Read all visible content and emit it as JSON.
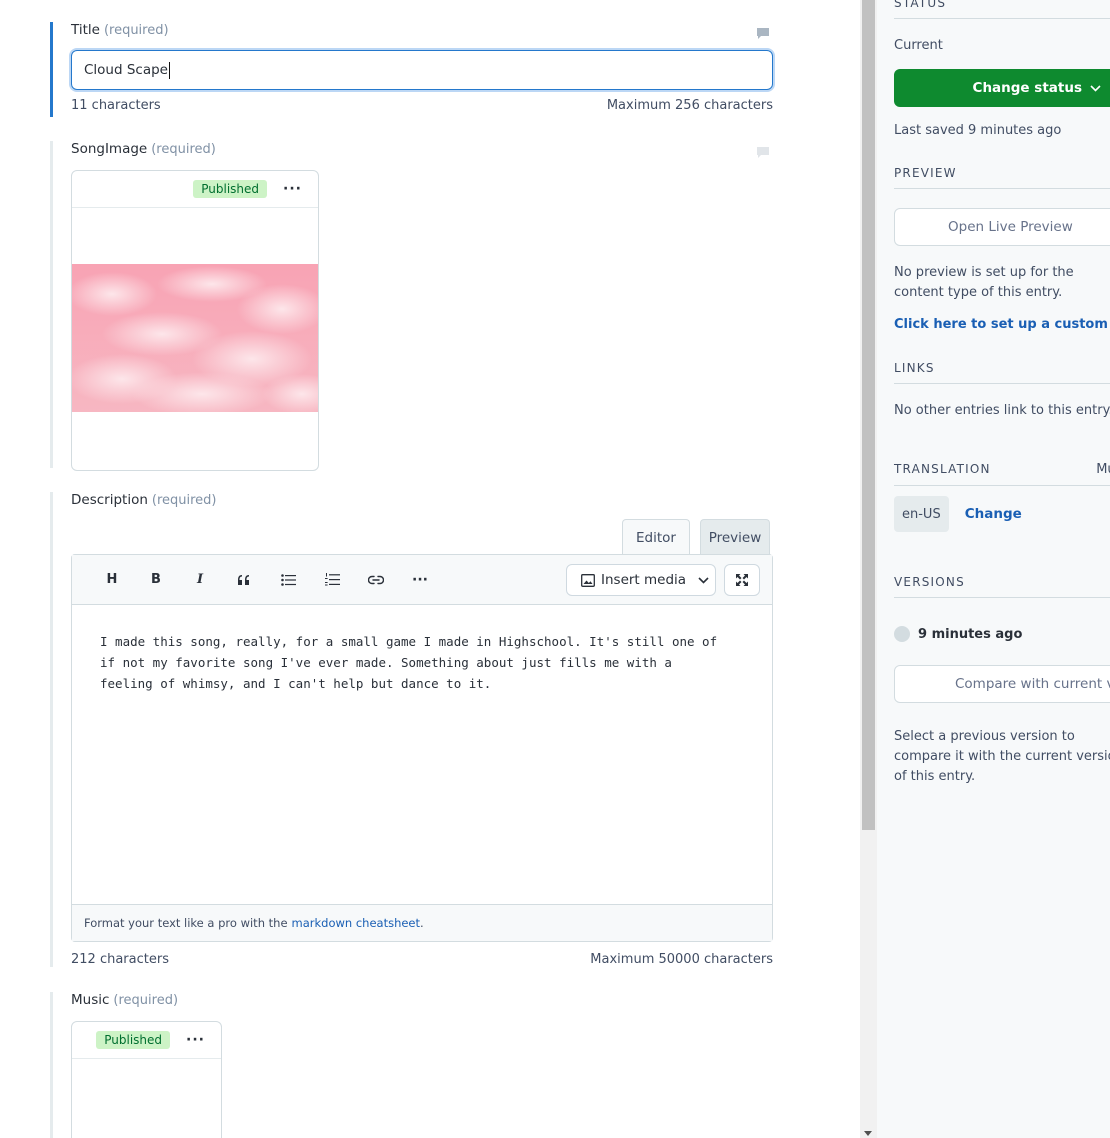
{
  "title_field": {
    "label": "Title",
    "required": "(required)",
    "value": "Cloud Scape",
    "count": "11 characters",
    "max": "Maximum 256 characters"
  },
  "song_image_field": {
    "label": "SongImage",
    "required": "(required)",
    "status": "Published",
    "more": "···"
  },
  "description_field": {
    "label": "Description",
    "required": "(required)",
    "tab_editor": "Editor",
    "tab_preview": "Preview",
    "toolbar": {
      "heading": "H",
      "bold": "B",
      "italic": "I",
      "more": "···",
      "insert_media": "Insert media"
    },
    "text": "I made this song, really, for a small game I made in Highschool. It's still one of\nif not my favorite song I've ever made. Something about just fills me with a\nfeeling of whimsy, and I can't help but dance to it.",
    "footer_prefix": "Format your text like a pro with the",
    "footer_link": "markdown cheatsheet",
    "footer_suffix": ".",
    "count": "212 characters",
    "max": "Maximum 50000 characters"
  },
  "music_field": {
    "label": "Music",
    "required": "(required)",
    "status": "Published",
    "more": "···"
  },
  "sidebar": {
    "status": {
      "heading": "STATUS",
      "current": "Current",
      "change_button": "Change status",
      "last_saved": "Last saved 9 minutes ago"
    },
    "preview": {
      "heading": "PREVIEW",
      "button": "Open Live Preview",
      "note": "No preview is set up for the content type of this entry.",
      "link": "Click here to set up a custom content preview"
    },
    "links": {
      "heading": "LINKS",
      "note": "No other entries link to this entry."
    },
    "translation": {
      "heading": "TRANSLATION",
      "mode": "Multi",
      "locale": "en-US",
      "change": "Change"
    },
    "versions": {
      "heading": "VERSIONS",
      "item": "9 minutes ago",
      "compare_button": "Compare with current version",
      "note": "Select a previous version to compare it with the current version of this entry."
    }
  },
  "colors": {
    "accent": "#2478cc",
    "primary_button": "#0e8a2f",
    "published_badge_bg": "#cdf3c6",
    "published_badge_text": "#006f2f",
    "link": "#1a5fb4"
  }
}
